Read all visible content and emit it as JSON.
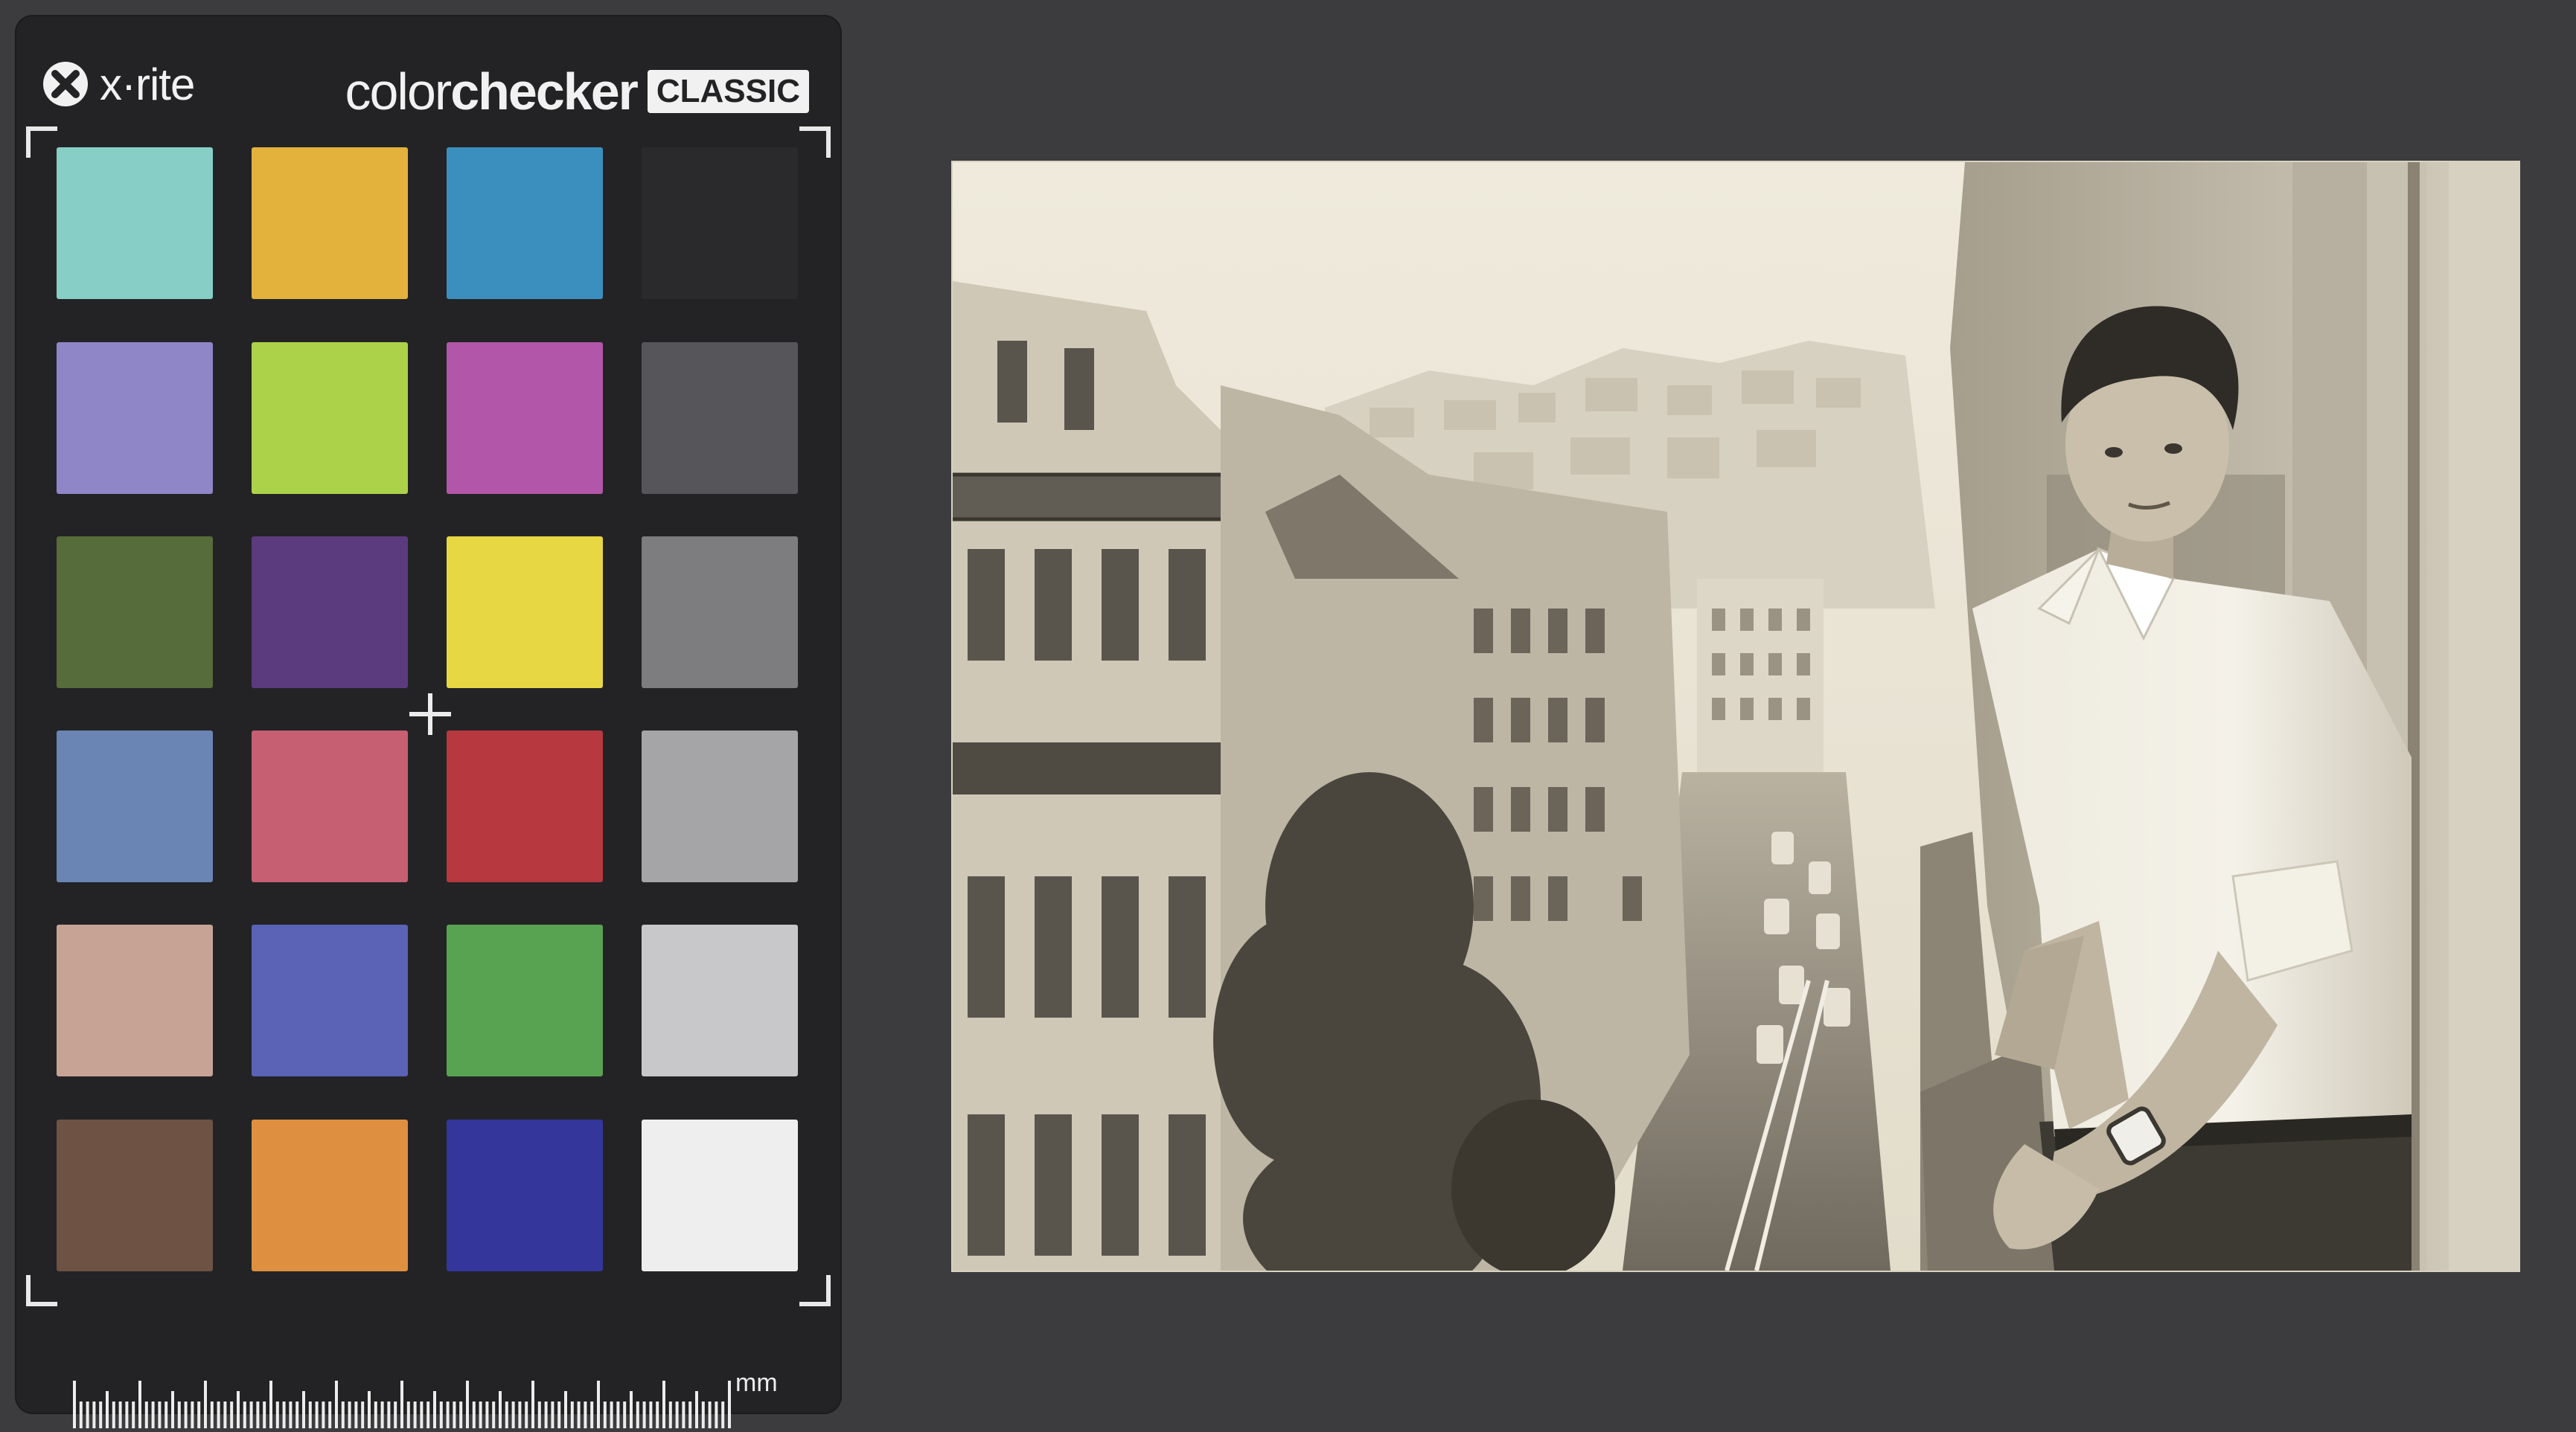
{
  "checker": {
    "brand": "x·rite",
    "product_light": "color",
    "product_bold": "checker",
    "badge": "CLASSIC",
    "unit_label": "mm",
    "patch_rows": [
      [
        "#86cec6",
        "#e3b23d",
        "#3b8fbf",
        "#2a2a2c"
      ],
      [
        "#8f86c7",
        "#acd24a",
        "#b256a9",
        "#55555a"
      ],
      [
        "#566c3a",
        "#5b3b7e",
        "#e7d742",
        "#7d7d80"
      ],
      [
        "#6a84b4",
        "#c75f72",
        "#b7383f",
        "#a5a5a8"
      ],
      [
        "#c7a396",
        "#5a63b6",
        "#58a352",
        "#c8c8cb"
      ],
      [
        "#6e5244",
        "#de9040",
        "#34369b",
        "#eeeeef"
      ]
    ]
  },
  "photo": {
    "subject_icon": "man-on-balcony-photo"
  }
}
